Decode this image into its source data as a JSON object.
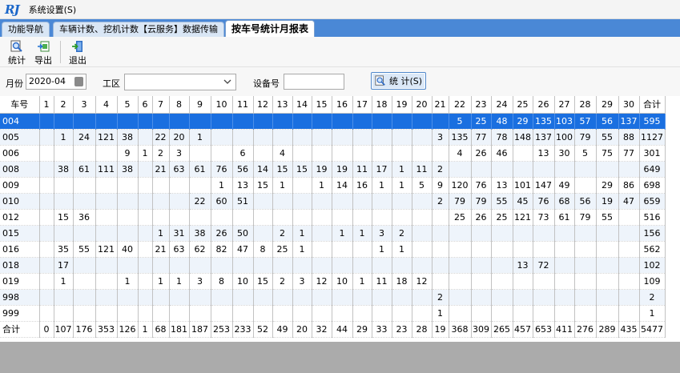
{
  "app": {
    "logo": "RJ",
    "menu": [
      "系统设置(S)"
    ]
  },
  "tabs": [
    "功能导航",
    "车辆计数、挖机计数【云服务】数据传输",
    "按车号统计月报表"
  ],
  "active_tab": 2,
  "toolbar": {
    "stat_label": "统计",
    "export_label": "导出",
    "exit_label": "退出"
  },
  "filters": {
    "month_label": "月份",
    "month_value": "2020-04",
    "site_label": "工区",
    "site_value": "",
    "device_label": "设备号",
    "device_value": "",
    "stat_button_label": "统 计(S)"
  },
  "grid": {
    "columns": [
      "车号",
      "1",
      "2",
      "3",
      "4",
      "5",
      "6",
      "7",
      "8",
      "9",
      "10",
      "11",
      "12",
      "13",
      "14",
      "15",
      "16",
      "17",
      "18",
      "19",
      "20",
      "21",
      "22",
      "23",
      "24",
      "25",
      "26",
      "27",
      "28",
      "29",
      "30",
      "合计"
    ],
    "selected_row": 0,
    "rows": [
      [
        "004",
        "",
        "",
        "",
        "",
        "",
        "",
        "",
        "",
        "",
        "",
        "",
        "",
        "",
        "",
        "",
        "",
        "",
        "",
        "",
        "",
        "",
        "5",
        "25",
        "48",
        "29",
        "135",
        "103",
        "57",
        "56",
        "137",
        "595"
      ],
      [
        "005",
        "",
        "1",
        "24",
        "121",
        "38",
        "",
        "22",
        "20",
        "1",
        "",
        "",
        "",
        "",
        "",
        "",
        "",
        "",
        "",
        "",
        "",
        "3",
        "135",
        "77",
        "78",
        "148",
        "137",
        "100",
        "79",
        "55",
        "88",
        "1127"
      ],
      [
        "006",
        "",
        "",
        "",
        "",
        "9",
        "1",
        "2",
        "3",
        "",
        "",
        "6",
        "",
        "4",
        "",
        "",
        "",
        "",
        "",
        "",
        "",
        "",
        "4",
        "26",
        "46",
        "",
        "13",
        "30",
        "5",
        "75",
        "77",
        "301"
      ],
      [
        "008",
        "",
        "38",
        "61",
        "111",
        "38",
        "",
        "21",
        "63",
        "61",
        "76",
        "56",
        "14",
        "15",
        "15",
        "19",
        "19",
        "11",
        "17",
        "1",
        "11",
        "2",
        "",
        "",
        "",
        "",
        "",
        "",
        "",
        "",
        "",
        "649"
      ],
      [
        "009",
        "",
        "",
        "",
        "",
        "",
        "",
        "",
        "",
        "",
        "1",
        "13",
        "15",
        "1",
        "",
        "1",
        "14",
        "16",
        "1",
        "1",
        "5",
        "9",
        "120",
        "76",
        "13",
        "101",
        "147",
        "49",
        "",
        "29",
        "86",
        "698"
      ],
      [
        "010",
        "",
        "",
        "",
        "",
        "",
        "",
        "",
        "",
        "22",
        "60",
        "51",
        "",
        "",
        "",
        "",
        "",
        "",
        "",
        "",
        "",
        "2",
        "79",
        "79",
        "55",
        "45",
        "76",
        "68",
        "56",
        "19",
        "47",
        "659"
      ],
      [
        "012",
        "",
        "15",
        "36",
        "",
        "",
        "",
        "",
        "",
        "",
        "",
        "",
        "",
        "",
        "",
        "",
        "",
        "",
        "",
        "",
        "",
        "",
        "25",
        "26",
        "25",
        "121",
        "73",
        "61",
        "79",
        "55",
        "",
        "516"
      ],
      [
        "015",
        "",
        "",
        "",
        "",
        "",
        "",
        "1",
        "31",
        "38",
        "26",
        "50",
        "",
        "2",
        "1",
        "",
        "1",
        "1",
        "3",
        "2",
        "",
        "",
        "",
        "",
        "",
        "",
        "",
        "",
        "",
        "",
        "",
        "156"
      ],
      [
        "016",
        "",
        "35",
        "55",
        "121",
        "40",
        "",
        "21",
        "63",
        "62",
        "82",
        "47",
        "8",
        "25",
        "1",
        "",
        "",
        "",
        "1",
        "1",
        "",
        "",
        "",
        "",
        "",
        "",
        "",
        "",
        "",
        "",
        "",
        "562"
      ],
      [
        "018",
        "",
        "17",
        "",
        "",
        "",
        "",
        "",
        "",
        "",
        "",
        "",
        "",
        "",
        "",
        "",
        "",
        "",
        "",
        "",
        "",
        "",
        "",
        "",
        "",
        "13",
        "72",
        "",
        "",
        "",
        "",
        "102"
      ],
      [
        "019",
        "",
        "1",
        "",
        "",
        "1",
        "",
        "1",
        "1",
        "3",
        "8",
        "10",
        "15",
        "2",
        "3",
        "12",
        "10",
        "1",
        "11",
        "18",
        "12",
        "",
        "",
        "",
        "",
        "",
        "",
        "",
        "",
        "",
        "",
        "109"
      ],
      [
        "998",
        "",
        "",
        "",
        "",
        "",
        "",
        "",
        "",
        "",
        "",
        "",
        "",
        "",
        "",
        "",
        "",
        "",
        "",
        "",
        "",
        "2",
        "",
        "",
        "",
        "",
        "",
        "",
        "",
        "",
        "",
        "2"
      ],
      [
        "999",
        "",
        "",
        "",
        "",
        "",
        "",
        "",
        "",
        "",
        "",
        "",
        "",
        "",
        "",
        "",
        "",
        "",
        "",
        "",
        "",
        "1",
        "",
        "",
        "",
        "",
        "",
        "",
        "",
        "",
        "",
        "1"
      ]
    ],
    "total_row": [
      "合计",
      "0",
      "107",
      "176",
      "353",
      "126",
      "1",
      "68",
      "181",
      "187",
      "253",
      "233",
      "52",
      "49",
      "20",
      "32",
      "44",
      "29",
      "33",
      "23",
      "28",
      "19",
      "368",
      "309",
      "265",
      "457",
      "653",
      "411",
      "276",
      "289",
      "435",
      "5477"
    ]
  },
  "colors": {
    "tab_strip": "#4a88d6",
    "selected_row": "#1a6fe0",
    "alt_row": "#eef4fb",
    "below_grid": "#ababab"
  },
  "icons": [
    "magnifier-icon",
    "export-icon",
    "exit-icon",
    "chevron-down-icon",
    "calendar-icon"
  ]
}
